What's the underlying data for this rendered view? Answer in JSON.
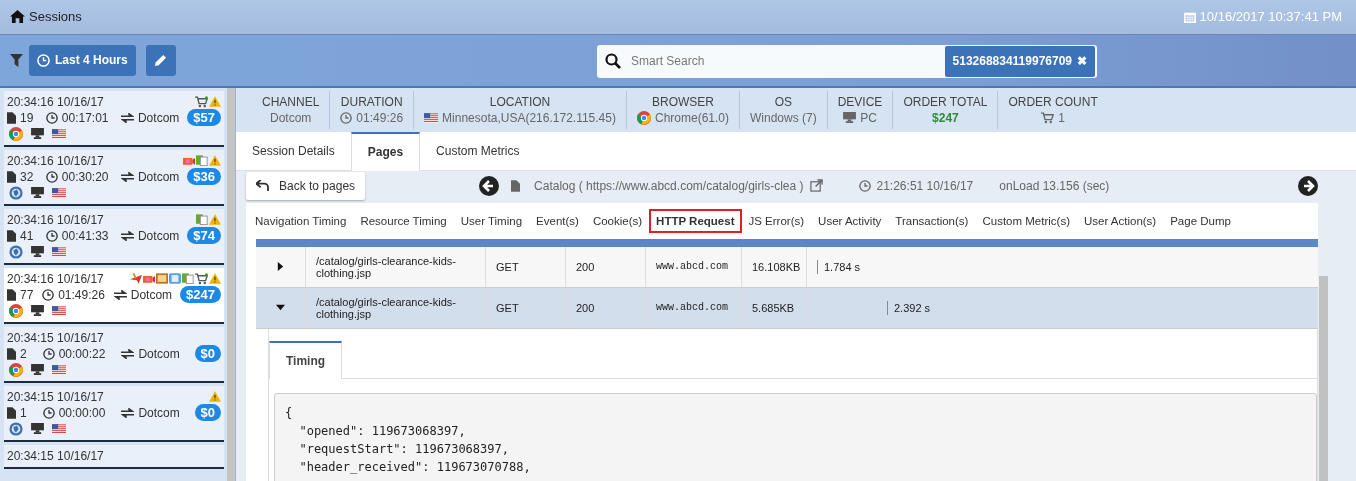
{
  "title_bar": {
    "title": "Sessions",
    "datetime": "10/16/2017 10:37:41 PM"
  },
  "toolbar": {
    "time_range_button": "Last 4 Hours",
    "search": {
      "placeholder": "Smart Search",
      "tags": [
        {
          "label": "513268834119976709",
          "remove": "✖"
        }
      ]
    }
  },
  "sessions": [
    {
      "time": "20:34:16 10/16/17",
      "pages": "19",
      "duration": "00:17:01",
      "channel": "Dotcom",
      "amount": "$57",
      "browser": {
        "kind": "chrome"
      },
      "selected": false,
      "flags": [
        {
          "kind": "cart"
        },
        {
          "kind": "warning"
        }
      ]
    },
    {
      "time": "20:34:16 10/16/17",
      "pages": "32",
      "duration": "00:30:20",
      "channel": "Dotcom",
      "amount": "$36",
      "browser": {
        "kind": "other"
      },
      "selected": false,
      "flags": [
        {
          "kind": "media"
        },
        {
          "kind": "document"
        },
        {
          "kind": "warning"
        }
      ]
    },
    {
      "time": "20:34:16 10/16/17",
      "pages": "41",
      "duration": "00:41:33",
      "channel": "Dotcom",
      "amount": "$74",
      "browser": {
        "kind": "other"
      },
      "selected": false,
      "flags": [
        {
          "kind": "document"
        },
        {
          "kind": "warning"
        }
      ]
    },
    {
      "time": "20:34:16 10/16/17",
      "pages": "77",
      "duration": "01:49:26",
      "channel": "Dotcom",
      "amount": "$247",
      "browser": {
        "kind": "chrome"
      },
      "selected": true,
      "flags": [
        {
          "kind": "plane"
        },
        {
          "kind": "media"
        },
        {
          "kind": "picture"
        },
        {
          "kind": "info"
        },
        {
          "kind": "document"
        },
        {
          "kind": "cart"
        },
        {
          "kind": "warning"
        }
      ]
    },
    {
      "time": "20:34:15 10/16/17",
      "pages": "2",
      "duration": "00:00:22",
      "channel": "Dotcom",
      "amount": "$0",
      "browser": {
        "kind": "chrome"
      },
      "selected": false
    },
    {
      "time": "20:34:15 10/16/17",
      "pages": "1",
      "duration": "00:00:00",
      "channel": "Dotcom",
      "amount": "$0",
      "browser": {
        "kind": "other"
      },
      "selected": false,
      "flags": [
        {
          "kind": "warning"
        }
      ]
    },
    {
      "time": "20:34:15 10/16/17",
      "selected": false
    }
  ],
  "summary": [
    {
      "kind": "plain",
      "label": "CHANNEL",
      "value": "Dotcom"
    },
    {
      "kind": "duration",
      "label": "DURATION",
      "value": "01:49:26"
    },
    {
      "kind": "location",
      "label": "LOCATION",
      "value": "Minnesota,USA(216.172.115.45)"
    },
    {
      "kind": "browser",
      "label": "BROWSER",
      "value": "Chrome(61.0)"
    },
    {
      "kind": "plain",
      "label": "OS",
      "value": "Windows (7)"
    },
    {
      "kind": "device",
      "label": "DEVICE",
      "value": "PC"
    },
    {
      "kind": "total",
      "label": "ORDER TOTAL",
      "value": "$247"
    },
    {
      "kind": "count",
      "label": "ORDER COUNT",
      "value": "1"
    }
  ],
  "tabs": [
    {
      "label": "Session Details",
      "selected": false
    },
    {
      "label": "Pages",
      "selected": true
    },
    {
      "label": "Custom Metrics",
      "selected": false
    }
  ],
  "page_nav": {
    "back_button": "Back to pages",
    "page": "Catalog ( https://www.abcd.com/catalog/girls-clea )",
    "time": "21:26:51 10/16/17",
    "onload": "onLoad 13.156 (sec)"
  },
  "sub_tabs": [
    {
      "label": "Navigation Timing",
      "selected": false
    },
    {
      "label": "Resource Timing",
      "selected": false
    },
    {
      "label": "User Timing",
      "selected": false
    },
    {
      "label": "Event(s)",
      "selected": false
    },
    {
      "label": "Cookie(s)",
      "selected": false
    },
    {
      "label": "HTTP Request",
      "selected": true
    },
    {
      "label": "JS Error(s)",
      "selected": false
    },
    {
      "label": "User Activity",
      "selected": false
    },
    {
      "label": "Transaction(s)",
      "selected": false
    },
    {
      "label": "Custom Metric(s)",
      "selected": false
    },
    {
      "label": "User Action(s)",
      "selected": false
    },
    {
      "label": "Page Dump",
      "selected": false
    }
  ],
  "requests": [
    {
      "expanded": false,
      "url": "/catalog/girls-clearance-kids-clothing.jsp",
      "method": "GET",
      "status": "200",
      "domain": "www.abcd.com",
      "size": "16.108KB",
      "time": "1.784 s"
    },
    {
      "expanded": true,
      "url": "/catalog/girls-clearance-kids-clothing.jsp",
      "method": "GET",
      "status": "200",
      "domain": "www.abcd.com",
      "size": "5.685KB",
      "time": "2.392 s"
    }
  ],
  "detail": {
    "tabs": [
      {
        "label": "Timing",
        "selected": true
      }
    ],
    "code_lines": [
      "{",
      "  \"opened\": 119673068397,",
      "  \"requestStart\": 119673068397,",
      "  \"header_received\": 119673070788,"
    ]
  }
}
